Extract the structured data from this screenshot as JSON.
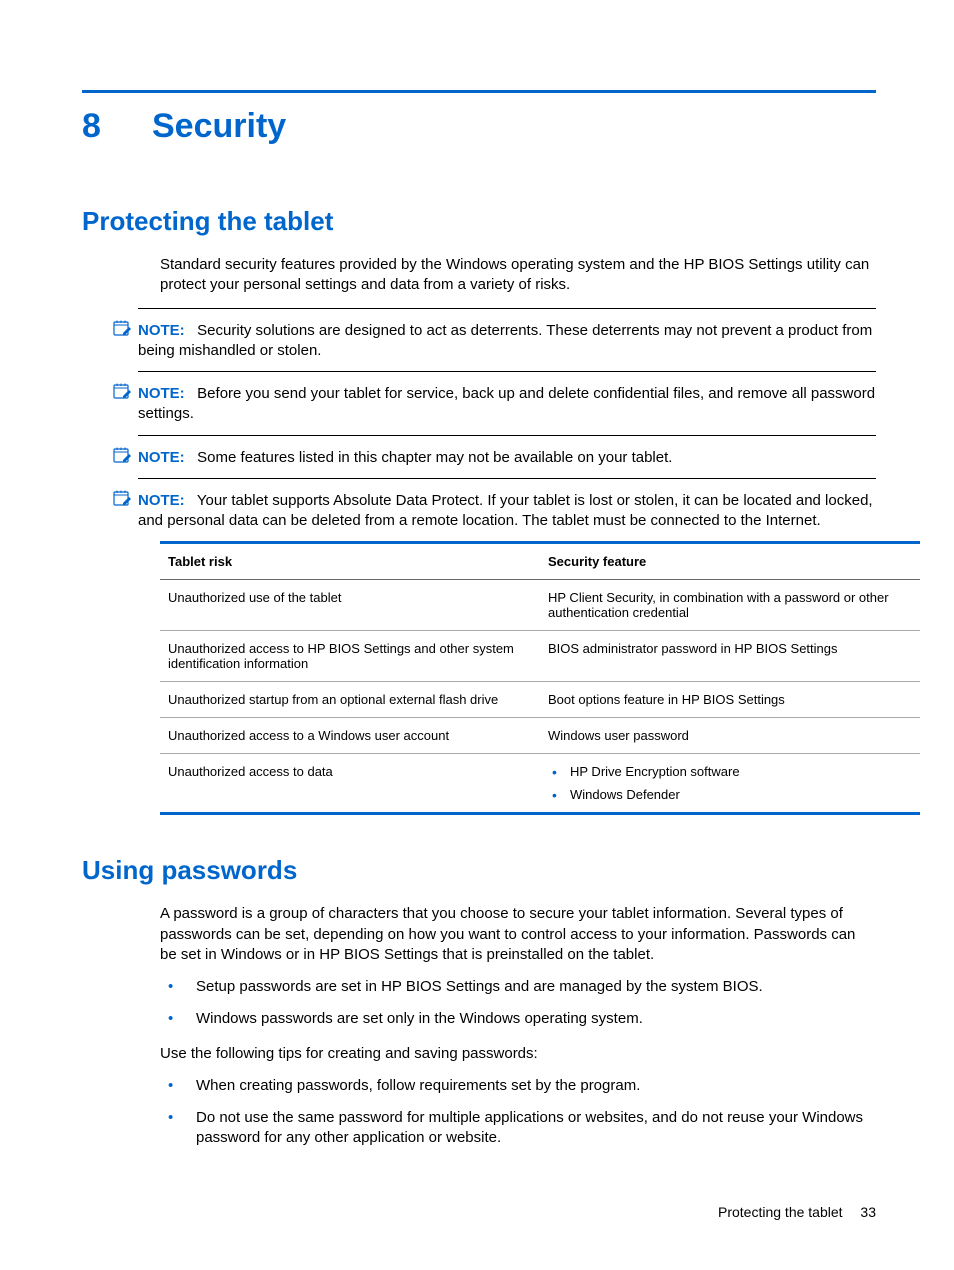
{
  "chapter": {
    "number": "8",
    "title": "Security"
  },
  "section1": {
    "heading": "Protecting the tablet",
    "intro": "Standard security features provided by the Windows operating system and the HP BIOS Settings utility can protect your personal settings and data from a variety of risks.",
    "notes": [
      {
        "label": "NOTE:",
        "text": "Security solutions are designed to act as deterrents. These deterrents may not prevent a product from being mishandled or stolen."
      },
      {
        "label": "NOTE:",
        "text": "Before you send your tablet for service, back up and delete confidential files, and remove all password settings."
      },
      {
        "label": "NOTE:",
        "text": "Some features listed in this chapter may not be available on your tablet."
      },
      {
        "label": "NOTE:",
        "text": "Your tablet supports Absolute Data Protect. If your tablet is lost or stolen, it can be located and locked, and personal data can be deleted from a remote location. The tablet must be connected to the Internet."
      }
    ],
    "table": {
      "headers": [
        "Tablet risk",
        "Security feature"
      ],
      "rows": [
        {
          "risk": "Unauthorized use of the tablet",
          "feature": "HP Client Security, in combination with a password or other authentication credential"
        },
        {
          "risk": "Unauthorized access to HP BIOS Settings and other system identification information",
          "feature": "BIOS administrator password in HP BIOS Settings"
        },
        {
          "risk": "Unauthorized startup from an optional external flash drive",
          "feature": "Boot options feature in HP BIOS Settings"
        },
        {
          "risk": "Unauthorized access to a Windows user account",
          "feature": "Windows user password"
        },
        {
          "risk": "Unauthorized access to data",
          "feature_list": [
            "HP Drive Encryption software",
            "Windows Defender"
          ]
        }
      ]
    }
  },
  "section2": {
    "heading": "Using passwords",
    "intro": "A password is a group of characters that you choose to secure your tablet information. Several types of passwords can be set, depending on how you want to control access to your information. Passwords can be set in Windows or in HP BIOS Settings that is preinstalled on the tablet.",
    "bullets1": [
      "Setup passwords are set in HP BIOS Settings and are managed by the system BIOS.",
      "Windows passwords are set only in the Windows operating system."
    ],
    "tips_intro": "Use the following tips for creating and saving passwords:",
    "bullets2": [
      "When creating passwords, follow requirements set by the program.",
      "Do not use the same password for multiple applications or websites, and do not reuse your Windows password for any other application or website."
    ]
  },
  "footer": {
    "section": "Protecting the tablet",
    "page": "33"
  }
}
